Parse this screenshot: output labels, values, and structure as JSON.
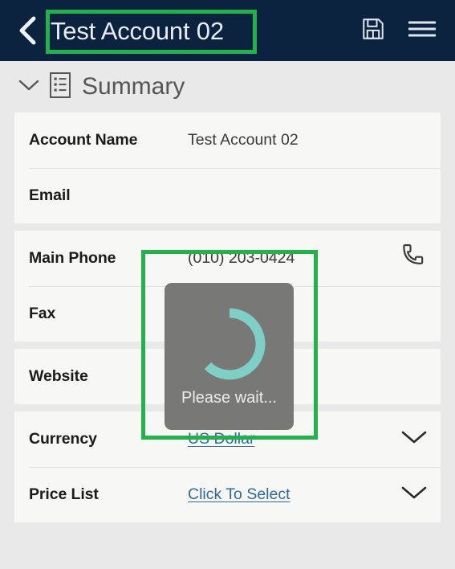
{
  "appbar": {
    "title": "Test Account 02",
    "back_icon": "chevron-left-icon",
    "save_icon": "floppy-disk-save-icon",
    "menu_icon": "hamburger-menu-icon",
    "background_color": "#0c2340",
    "title_color": "#e9edf2"
  },
  "section": {
    "title": "Summary",
    "collapse_icon": "chevron-down-icon",
    "section_icon": "list-document-icon",
    "expanded": true
  },
  "form": {
    "cards": [
      {
        "rows": [
          {
            "label": "Account Name",
            "value": "Test Account 02",
            "type": "text",
            "trailing_icon": ""
          },
          {
            "label": "Email",
            "value": "",
            "type": "text",
            "trailing_icon": ""
          }
        ]
      },
      {
        "rows": [
          {
            "label": "Main Phone",
            "value": "(010) 203-0424",
            "type": "text",
            "trailing_icon": "phone-icon"
          },
          {
            "label": "Fax",
            "value": "",
            "type": "text",
            "trailing_icon": ""
          }
        ]
      },
      {
        "rows": [
          {
            "label": "Website",
            "value": "",
            "type": "text",
            "trailing_icon": ""
          }
        ]
      },
      {
        "rows": [
          {
            "label": "Currency",
            "value": "US Dollar",
            "type": "link",
            "trailing_icon": "chevron-down-icon"
          },
          {
            "label": "Price List",
            "value": "Click To Select",
            "type": "link",
            "trailing_icon": "chevron-down-icon"
          }
        ]
      }
    ]
  },
  "loading": {
    "text": "Please wait...",
    "spinner_color": "#7fcfc6",
    "overlay_color": "#787876",
    "visible": true
  },
  "annotations": {
    "highlight_color": "#22b14c",
    "boxes": [
      {
        "name": "title-highlight",
        "target": "appbar-title"
      },
      {
        "name": "phone-loading-highlight",
        "target": "main-phone-value-and-loading"
      }
    ]
  },
  "theme": {
    "page_background": "#e9e9e9",
    "card_background": "#f7f7f5",
    "label_color": "#1b1b1b",
    "value_color": "#3a3a3a",
    "link_color": "#2e6a9e",
    "divider_color": "#e3e3e1"
  }
}
